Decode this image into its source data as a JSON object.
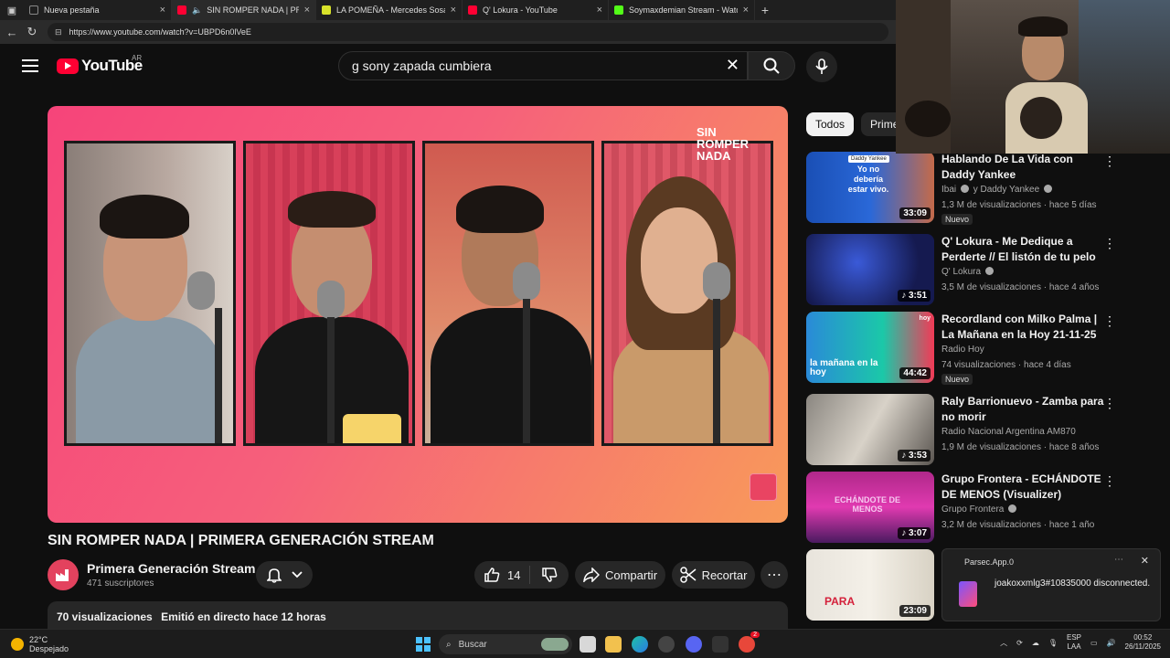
{
  "browser": {
    "tabs": [
      {
        "title": "Nueva pestaña",
        "color": "#555555"
      },
      {
        "title": "SIN ROMPER NADA | PRIMER",
        "color": "#ff0033"
      },
      {
        "title": "LA POMEÑA - Mercedes Sosa - Li",
        "color": "#d8e22a"
      },
      {
        "title": "Q' Lokura - YouTube",
        "color": "#ff0033"
      },
      {
        "title": "Soymaxdemian Stream - Watch L",
        "color": "#53fc18"
      }
    ],
    "url": "https://www.youtube.com/watch?v=UBPD6n0lVeE"
  },
  "youtube": {
    "logo_text": "YouTube",
    "region": "AR",
    "search_value": "g sony zapada cumbiera"
  },
  "video": {
    "overlay_logo": "SIN ROMPER NADA",
    "title": "SIN ROMPER NADA | PRIMERA GENERACIÓN STREAM",
    "channel": "Primera Generación Stream",
    "subscribers": "471 suscriptores",
    "likes": "14",
    "share_label": "Compartir",
    "clip_label": "Recortar",
    "views": "70 visualizaciones",
    "streamed": "Emitió en directo hace 12 horas"
  },
  "sidebar": {
    "chips": [
      "Todos",
      "Prime"
    ],
    "recommendations": [
      {
        "title": "Hablando De La Vida con Daddy Yankee",
        "channel": "Ibai",
        "channel_extra": "y Daddy Yankee",
        "meta": "1,3 M de visualizaciones · hace 5 días",
        "duration": "33:09",
        "badge": "Nuevo",
        "thumb_text": "Yo no debería estar vivo.",
        "thumb_tag": "Daddy Yankee"
      },
      {
        "title": "Q' Lokura - Me Dedique a Perderte // El listón de tu pelo ...",
        "channel": "Q' Lokura",
        "channel_extra": "",
        "meta": "3,5 M de visualizaciones · hace 4 años",
        "duration": "3:51",
        "badge": "",
        "thumb_text": "",
        "thumb_tag": ""
      },
      {
        "title": "Recordland con Milko Palma | La Mañana en la Hoy 21-11-25",
        "channel": "Radio Hoy",
        "channel_extra": "",
        "meta": "74 visualizaciones · hace 4 días",
        "duration": "44:42",
        "badge": "Nuevo",
        "thumb_text": "la mañana en la hoy",
        "thumb_tag": "hoy"
      },
      {
        "title": "Raly Barrionuevo - Zamba para no morir",
        "channel": "Radio Nacional Argentina AM870",
        "channel_extra": "",
        "meta": "1,9 M de visualizaciones · hace 8 años",
        "duration": "3:53",
        "badge": "",
        "thumb_text": "",
        "thumb_tag": ""
      },
      {
        "title": "Grupo Frontera - ECHÁNDOTE DE MENOS (Visualizer)",
        "channel": "Grupo Frontera",
        "channel_extra": "",
        "meta": "3,2 M de visualizaciones · hace 1 año",
        "duration": "3:07",
        "badge": "",
        "thumb_text": "ECHÁNDOTE DE MENOS",
        "thumb_tag": ""
      },
      {
        "title": "",
        "channel": "",
        "channel_extra": "",
        "meta": "",
        "duration": "23:09",
        "badge": "",
        "thumb_text": "PARA",
        "thumb_tag": ""
      }
    ]
  },
  "notification": {
    "app": "Parsec.App.0",
    "message": "joakoxxmlg3#10835000 disconnected."
  },
  "taskbar": {
    "temperature": "22°C",
    "weather": "Despejado",
    "search_placeholder": "Buscar",
    "lang_top": "ESP",
    "lang_bottom": "LAA",
    "time": "00:52",
    "date": "26/11/2025",
    "badge_count": "2"
  }
}
